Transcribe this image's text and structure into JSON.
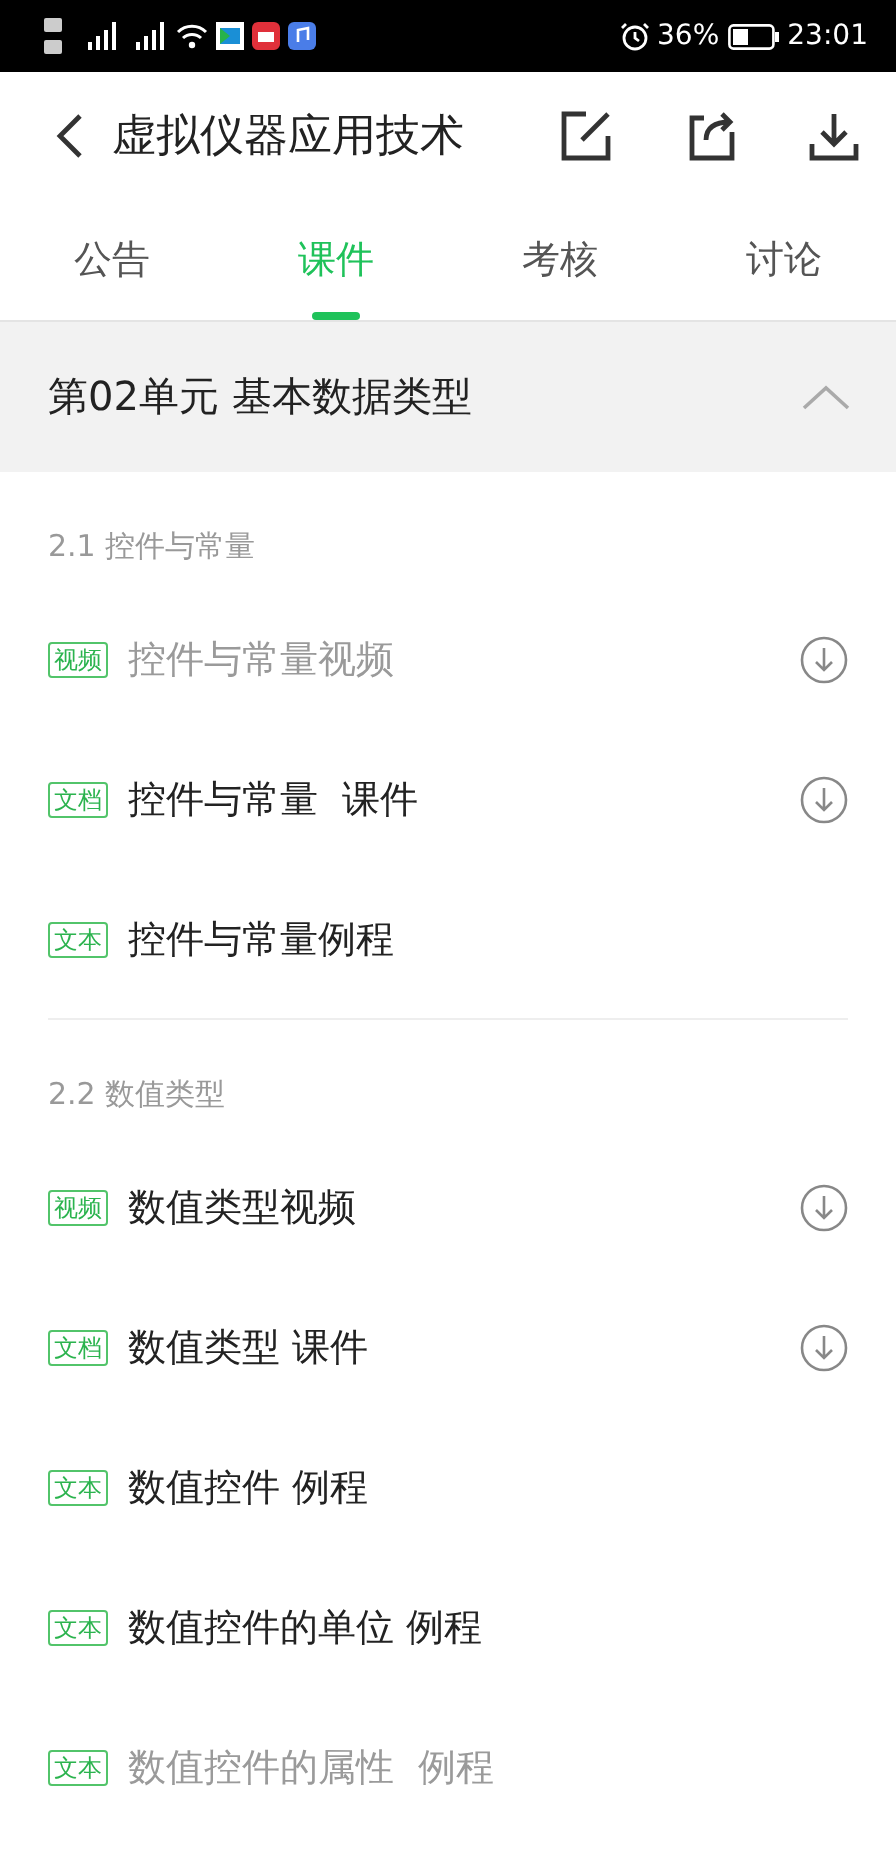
{
  "status_bar": {
    "battery": "36%",
    "time": "23:01"
  },
  "header": {
    "title": "虚拟仪器应用技术"
  },
  "tabs": [
    {
      "label": "公告",
      "selected": false
    },
    {
      "label": "课件",
      "selected": true
    },
    {
      "label": "考核",
      "selected": false
    },
    {
      "label": "讨论",
      "selected": false
    }
  ],
  "unit": {
    "title": "第02单元 基本数据类型",
    "expanded": true
  },
  "sections": [
    {
      "title": "2.1 控件与常量",
      "items": [
        {
          "tag": "视频",
          "title": "控件与常量视频",
          "viewed": true,
          "downloadable": true
        },
        {
          "tag": "文档",
          "title": "控件与常量  课件",
          "viewed": false,
          "downloadable": true
        },
        {
          "tag": "文本",
          "title": "控件与常量例程",
          "viewed": false,
          "downloadable": false
        }
      ]
    },
    {
      "title": "2.2 数值类型",
      "items": [
        {
          "tag": "视频",
          "title": "数值类型视频",
          "viewed": false,
          "downloadable": true
        },
        {
          "tag": "文档",
          "title": "数值类型 课件",
          "viewed": false,
          "downloadable": true
        },
        {
          "tag": "文本",
          "title": "数值控件 例程",
          "viewed": false,
          "downloadable": false
        },
        {
          "tag": "文本",
          "title": "数值控件的单位 例程",
          "viewed": false,
          "downloadable": false
        },
        {
          "tag": "文本",
          "title": "数值控件的属性  例程",
          "viewed": true,
          "downloadable": false
        }
      ]
    }
  ]
}
